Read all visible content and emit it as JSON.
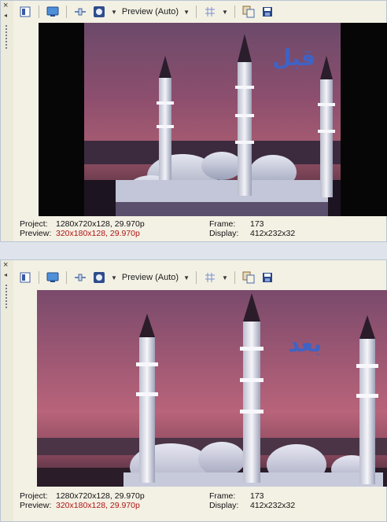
{
  "toolbar": {
    "preview_label": "Preview (Auto)"
  },
  "panels": [
    {
      "overlay_text": "قبل",
      "status": {
        "project_label": "Project:",
        "project_value": "1280x720x128, 29.970p",
        "preview_label": "Preview:",
        "preview_value": "320x180x128, 29.970p",
        "frame_label": "Frame:",
        "frame_value": "173",
        "display_label": "Display:",
        "display_value": "412x232x32"
      }
    },
    {
      "overlay_text": "بعد",
      "status": {
        "project_label": "Project:",
        "project_value": "1280x720x128, 29.970p",
        "preview_label": "Preview:",
        "preview_value": "320x180x128, 29.970p",
        "frame_label": "Frame:",
        "frame_value": "173",
        "display_label": "Display:",
        "display_value": "412x232x32"
      }
    }
  ],
  "colors": {
    "accent_red": "#b01414",
    "overlay_blue": "#3e63c6",
    "panel_bg": "#f3f1e4"
  },
  "icons": [
    "close-icon",
    "pin-arrow-icon",
    "grip-icon",
    "properties-icon",
    "monitor-icon",
    "split-screen-icon",
    "overlay-icon",
    "grid-icon",
    "copy-icon",
    "save-icon"
  ]
}
